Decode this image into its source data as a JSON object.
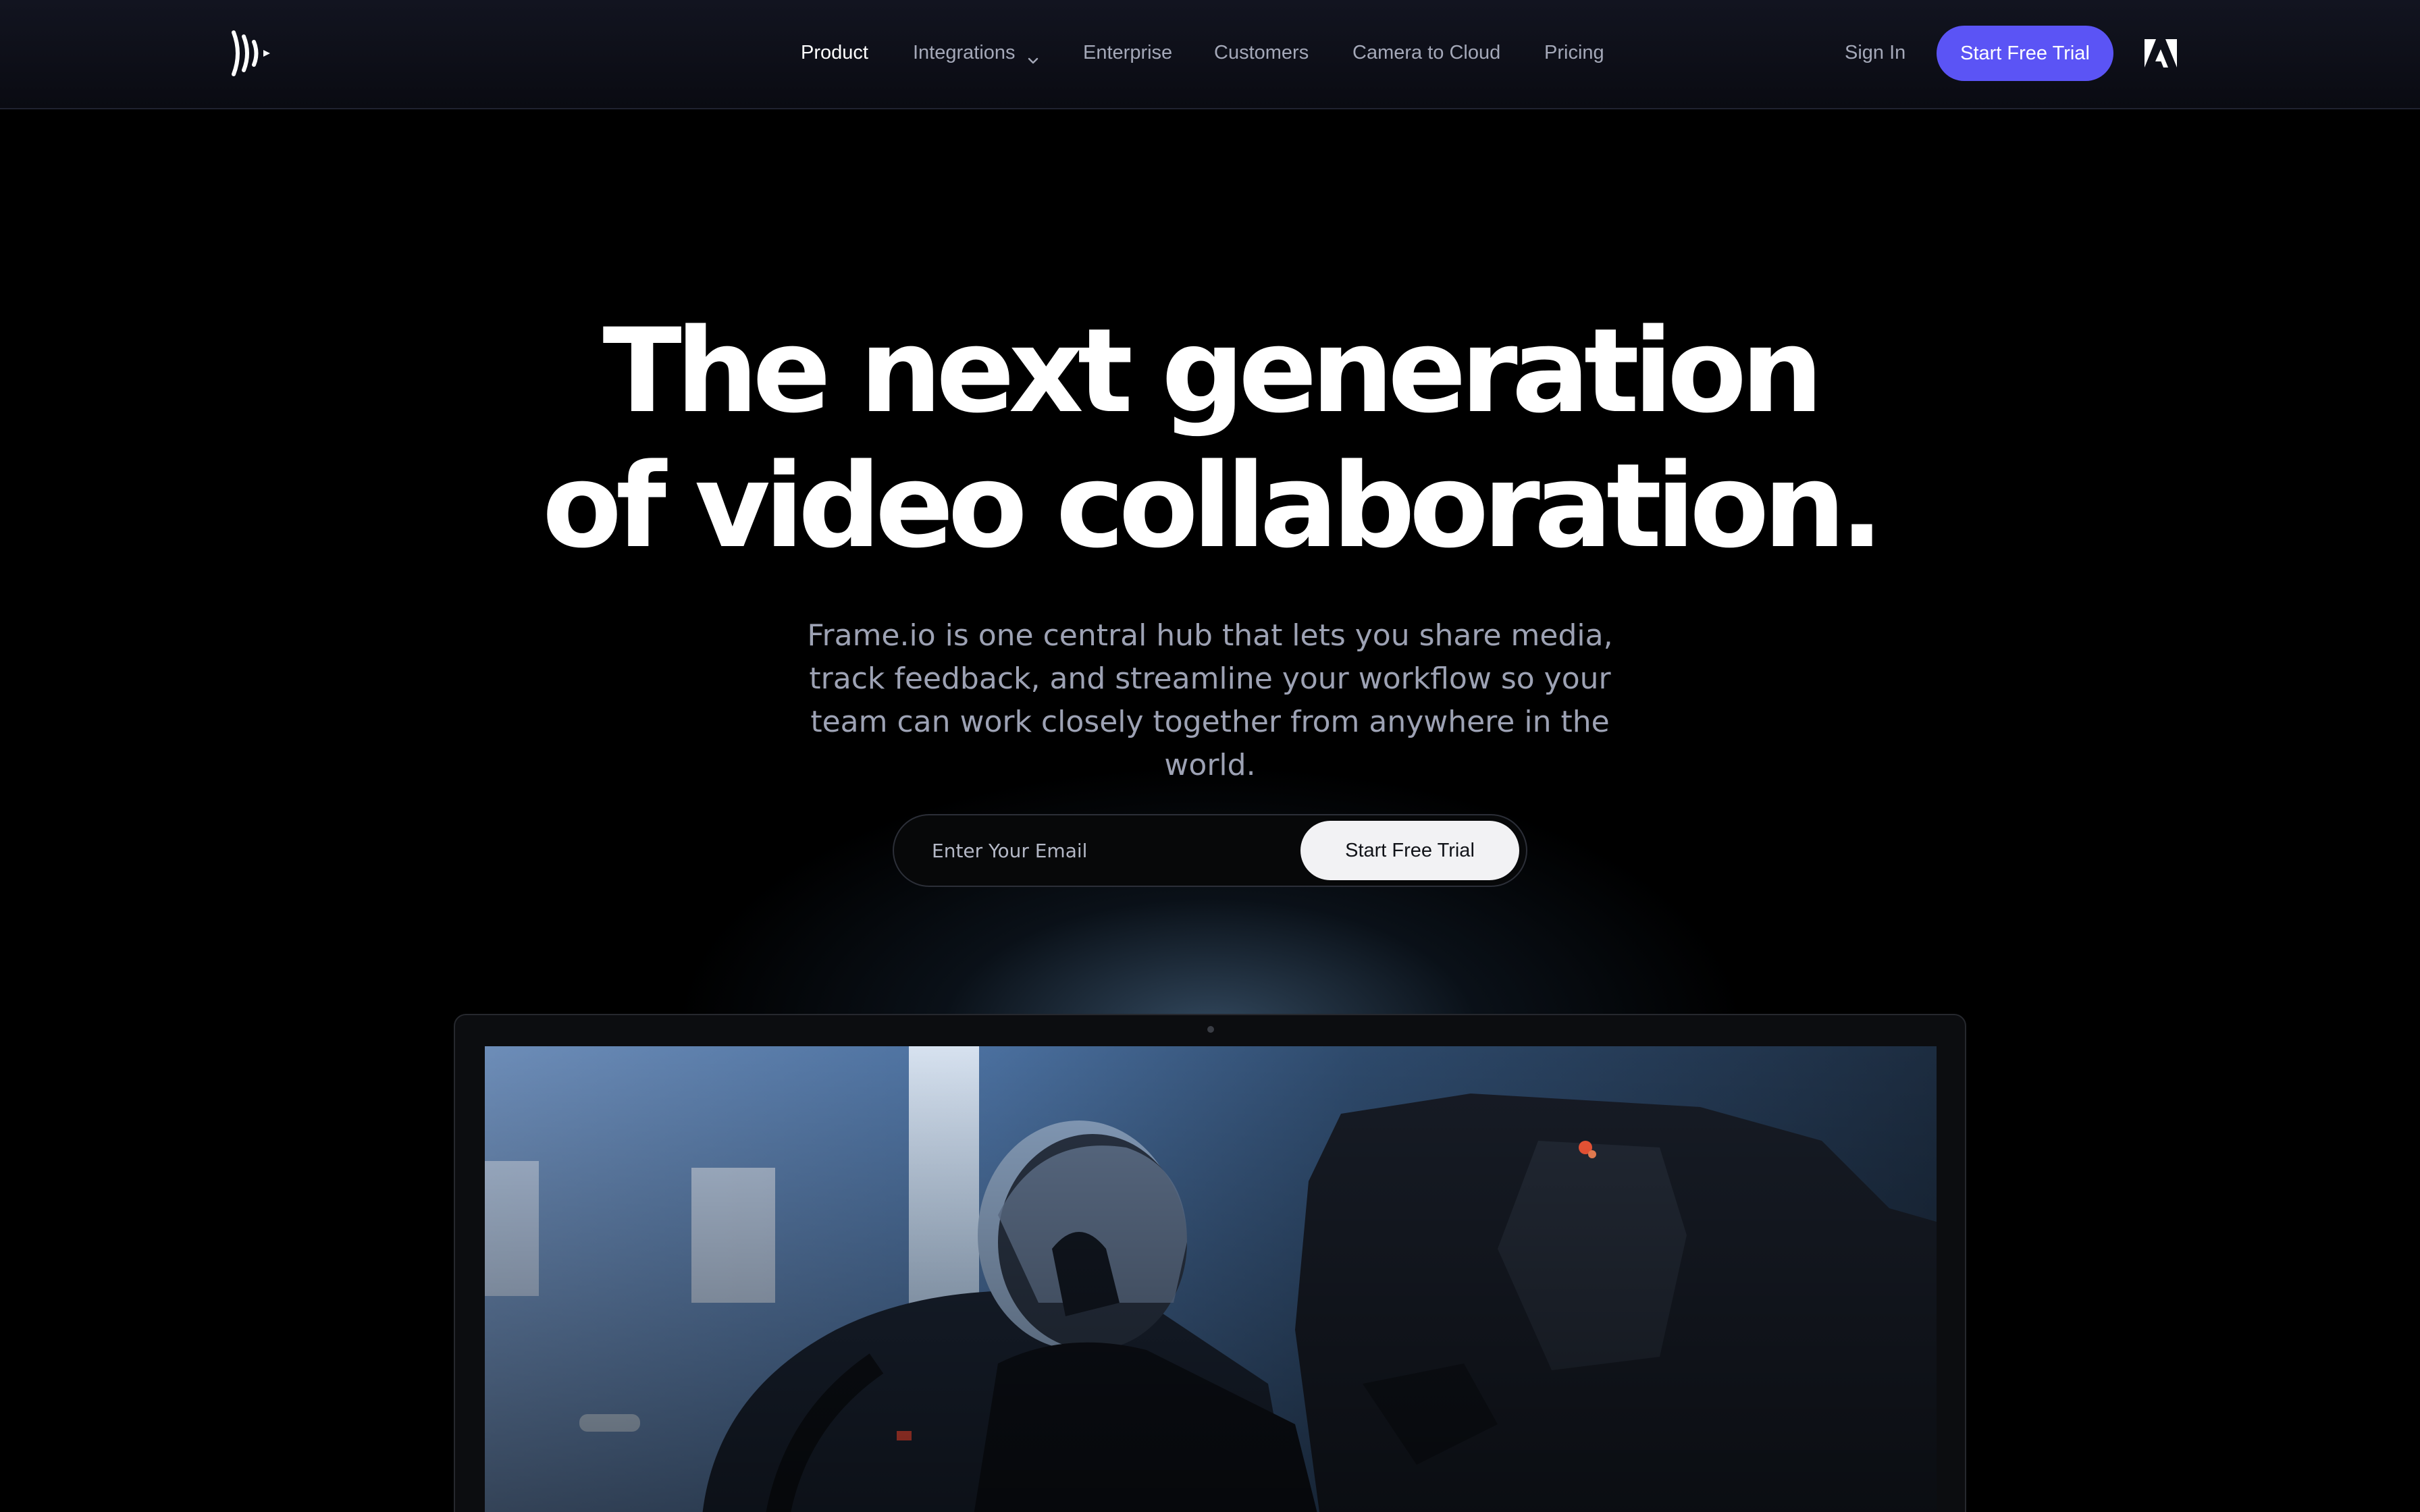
{
  "brand": {
    "logo_icon": "frameio-logo-icon",
    "accent_color": "#5b54f5"
  },
  "nav": {
    "links": [
      {
        "label": "Product",
        "active": true
      },
      {
        "label": "Integrations",
        "has_dropdown": true
      },
      {
        "label": "Enterprise"
      },
      {
        "label": "Customers"
      },
      {
        "label": "Camera to Cloud"
      },
      {
        "label": "Pricing"
      }
    ],
    "sign_in": "Sign In",
    "cta": "Start Free Trial",
    "adobe_icon": "adobe-logo-icon"
  },
  "hero": {
    "headline_line1": "The next generation",
    "headline_line2": "of video collaboration.",
    "subtext": "Frame.io is one central hub that lets you share media, track feedback, and streamline your workflow so your team can work closely together from anywhere in the world.",
    "email_placeholder": "Enter Your Email",
    "email_value": "",
    "cta": "Start Free Trial"
  },
  "device": {
    "type": "laptop",
    "screen_content": "video-frame-pilot-in-cockpit"
  }
}
